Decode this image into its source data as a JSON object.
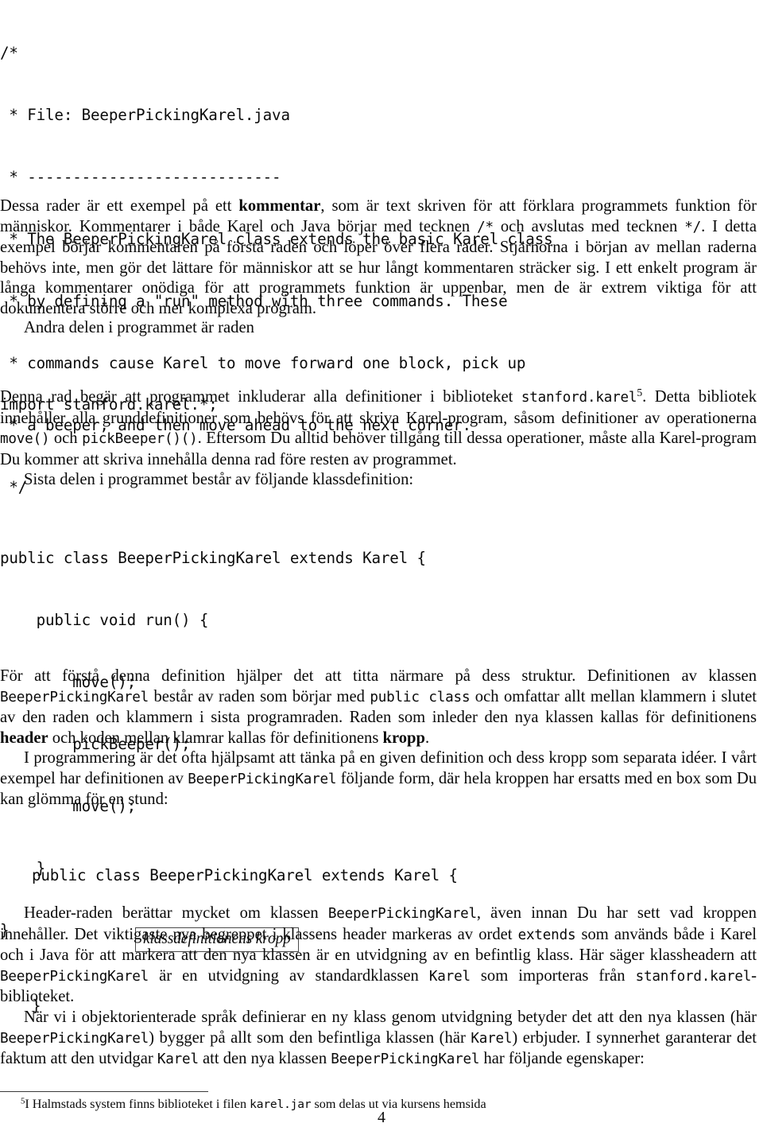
{
  "document": {
    "page_number": "4",
    "language": "sv"
  },
  "comment_block": {
    "lines": [
      "/*",
      " * File: BeeperPickingKarel.java",
      " * ----------------------------",
      " * The BeeperPickingKarel class extends the basic Karel class",
      " * by defining a \"run\" method with three commands. These",
      " * commands cause Karel to move forward one block, pick up",
      " * a beeper, and then move ahead to the next corner.",
      " */"
    ]
  },
  "paragraphs": {
    "p1": {
      "s1": "Dessa rader är ett exempel på ett ",
      "bold1": "kommentar",
      "s2": ", som är text skriven för att förklara programmets funktion för människor. Kommentarer i både Karel och Java börjar med tecknen ",
      "tt1": "/*",
      "s3": " och avslutas med tecknen ",
      "tt2": "*/",
      "s4": ". I detta exempel börjar kommentaren på första raden och löper över flera rader. Stjärnorna i början av mellan raderna behövs inte, men gör det lättare för människor att se hur långt kommentaren sträcker sig. I ett enkelt program är långa kommentarer onödiga för att programmets funktion är uppenbar, men de är extrem viktiga för att dokumentera större och mer komplexa program."
    },
    "p2": {
      "s1": "Andra delen i programmet är raden"
    },
    "p3": {
      "s1": "Denna rad begär att programmet inkluderar alla definitioner i biblioteket ",
      "tt1": "stanford.karel",
      "fnmark": "5",
      "s2": ". Detta bibliotek innehåller alla grunddefinitioner som behövs för att skriva Karel-program, såsom definitioner av operationerna ",
      "tt2": "move()",
      "s3": " och ",
      "tt3": "pickBeeper()()",
      "s4": ". Eftersom Du alltid behöver tillgång till dessa operationer, måste alla Karel-program Du kommer att skriva innehålla denna rad före resten av programmet."
    },
    "p4": {
      "s1": "Sista delen i programmet består av följande klassdefinition:"
    },
    "p5": {
      "s1": "För att förstå denna definition hjälper det att titta närmare på dess struktur. Definitionen av klassen ",
      "tt1": "BeeperPickingKarel",
      "s2": " består av raden som börjar med ",
      "tt2": "public class",
      "s3": " och omfattar allt mellan klammern i slutet av den raden och klammern i sista programraden. Raden som inleder den nya klassen kallas för definitionens ",
      "bold1": "header",
      "s4": " och koden mellan klamrar kallas för definitionens ",
      "bold2": "kropp",
      "s5": "."
    },
    "p6": {
      "s1": "I programmering är det ofta hjälpsamt att tänka på en given definition och dess kropp som separata idéer. I vårt exempel har definitionen av ",
      "tt1": "BeeperPickingKarel",
      "s2": " följande form, där hela kroppen har ersatts med en box som Du kan glömma för en stund:"
    },
    "p7": {
      "s1": "Header-raden berättar mycket om klassen ",
      "tt1": "BeeperPickingKarel",
      "s2": ", även innan Du har sett vad kroppen innehåller. Det viktigaste nya begreppet i klassens header markeras av ordet ",
      "tt2": "extends",
      "s3": " som används både i Karel och i Java för att markera att den nya klassen är en utvidgning av en befintlig klass. Här säger klassheadern att ",
      "tt3": "BeeperPickingKarel",
      "s4": " är en utvidgning av standardklassen ",
      "tt4": "Karel",
      "s5": " som importeras från ",
      "tt5": "stanford.karel",
      "s6": "-biblioteket."
    },
    "p8": {
      "s1": "När vi i objektorienterade språk definierar en ny klass genom utvidgning betyder det att den nya klassen (här ",
      "tt1": "BeeperPickingKarel",
      "s2": ") bygger på allt som den befintliga klassen (här ",
      "tt2": "Karel",
      "s3": ") erbjuder. I synnerhet garanterar det faktum att den utvidgar ",
      "tt3": "Karel",
      "s4": " att den nya klassen ",
      "tt4": "BeeperPickingKarel",
      "s5": " har följande egenskaper:"
    }
  },
  "import_block": {
    "line": "import stanford.karel.*;"
  },
  "class_block": {
    "lines": [
      "public class BeeperPickingKarel extends Karel {",
      "    public void run() {",
      "        move();",
      "        pickBeeper();",
      "        move();",
      "    }",
      "}"
    ]
  },
  "boxed_block": {
    "header": "public class BeeperPickingKarel extends Karel {",
    "box_label": "klassdefinitionens kropp",
    "closing": "}"
  },
  "footnote": {
    "marker": "5",
    "s1": "I Halmstads system finns biblioteket i filen ",
    "tt1": "karel.jar",
    "s2": " som delas ut via kursens hemsida"
  }
}
